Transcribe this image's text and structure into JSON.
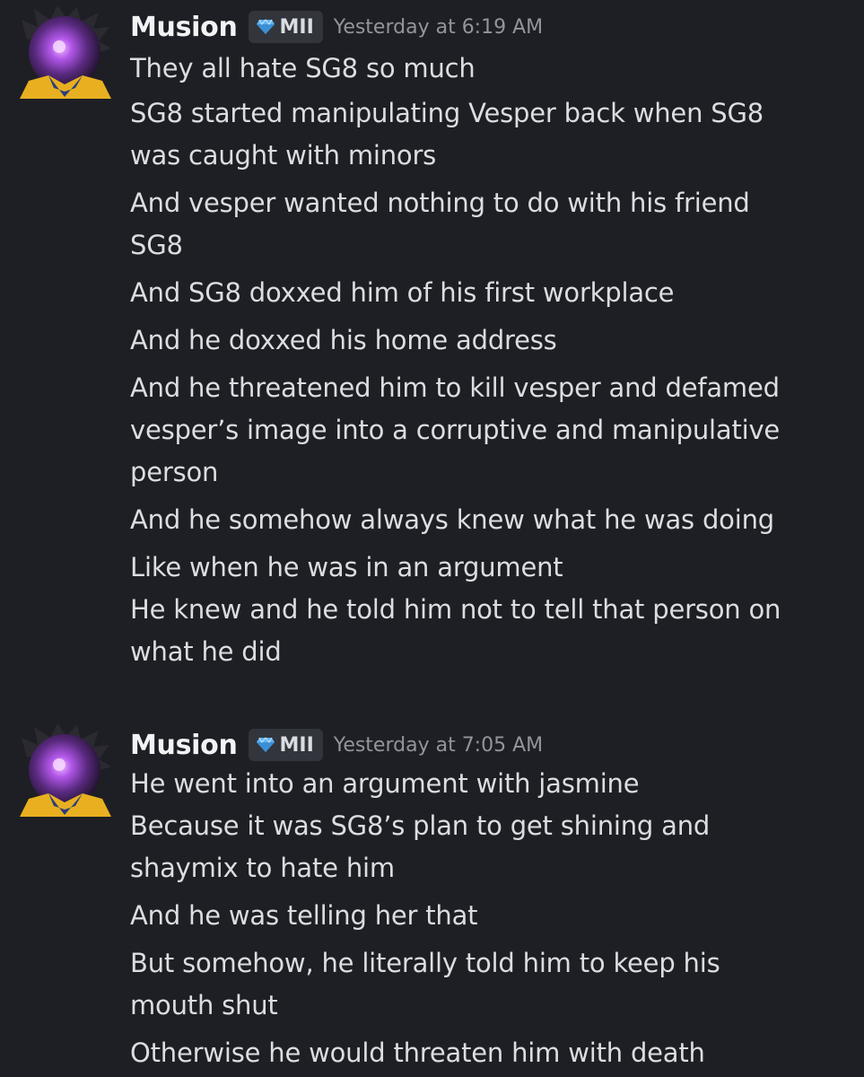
{
  "messages": [
    {
      "author": "Musion",
      "tag": "MII",
      "timestamp": "Yesterday at 6:19 AM",
      "lines": [
        "They all hate SG8 so much",
        "SG8 started manipulating Vesper back when SG8",
        "was caught with minors",
        "And vesper wanted nothing to do with his friend",
        "SG8",
        "And SG8 doxxed him of his first workplace",
        "And he doxxed his home address",
        "And he threatened him to kill vesper and defamed",
        "vesper’s image into a corruptive and manipulative",
        "person",
        "And he somehow always knew what he was doing",
        "Like when he was in an argument",
        "He knew and he told him not to tell that person on",
        "what he did"
      ]
    },
    {
      "author": "Musion",
      "tag": "MII",
      "timestamp": "Yesterday at 7:05 AM",
      "lines": [
        "He went into an argument with jasmine",
        "Because it was SG8’s plan to get shining and",
        "shaymix to hate him",
        "And he was telling her that",
        "But somehow, he literally told him to keep his",
        "mouth shut",
        "Otherwise he would threaten him with death"
      ]
    }
  ],
  "icons": {
    "avatar": "avatar-icon",
    "tag_icon": "diamond-icon"
  },
  "colors": {
    "background": "#1e1f24",
    "username": "#f2f3f5",
    "text": "#dbdee1",
    "timestamp": "#92959c",
    "tag_bg": "#33353c",
    "diamond": "#5fb3f5"
  }
}
